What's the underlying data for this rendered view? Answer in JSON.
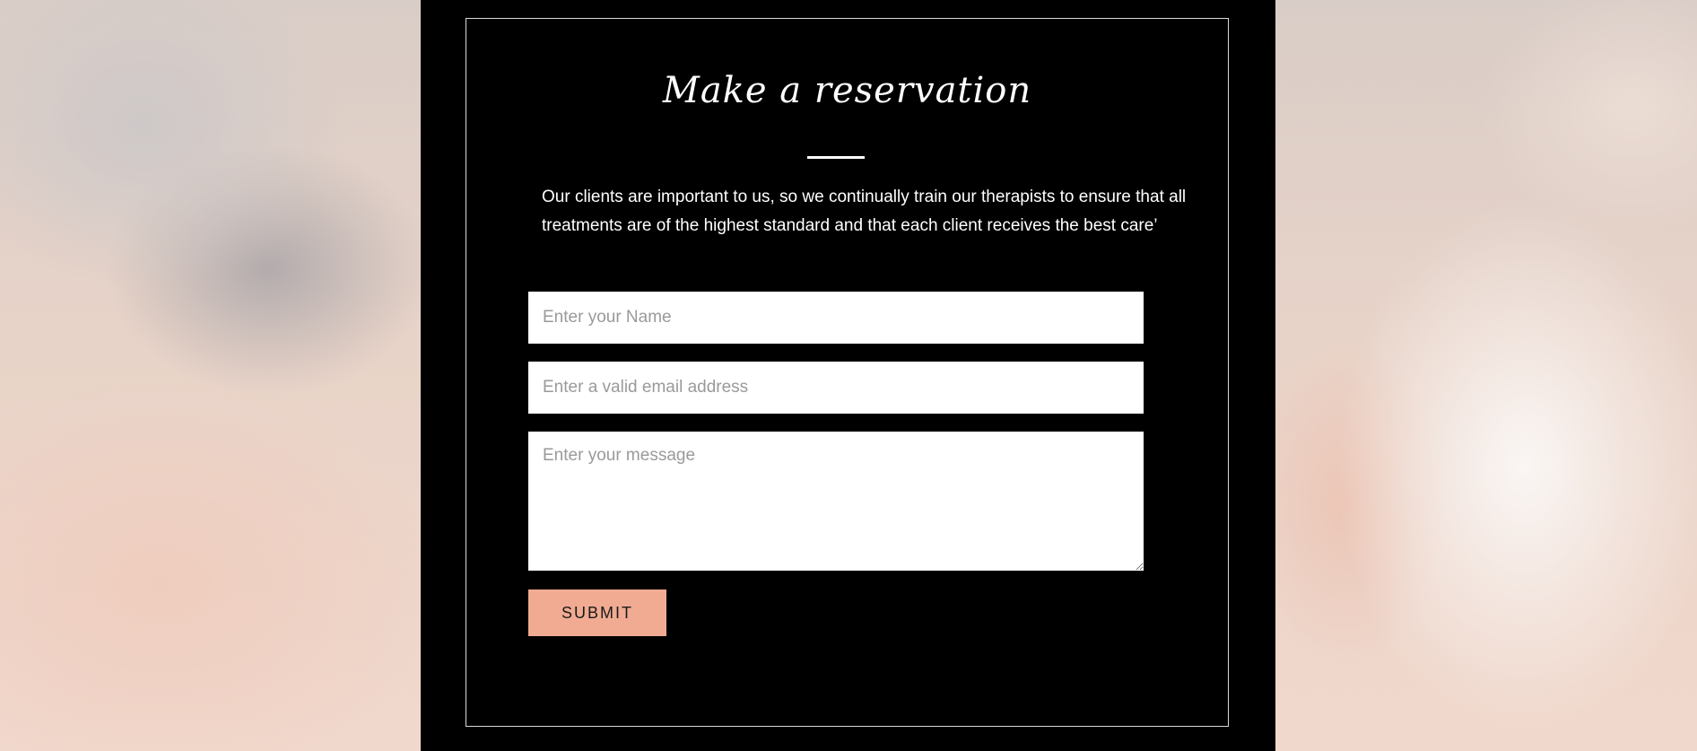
{
  "reservation": {
    "title": "Make a reservation",
    "intro": "Our clients are important to us, so we continually train our therapists to ensure that all treatments are of the highest standard and that each client receives the best care’",
    "form": {
      "name_placeholder": "Enter your Name",
      "email_placeholder": "Enter a valid email address",
      "message_placeholder": "Enter your message",
      "submit_label": "SUBMIT"
    }
  },
  "colors": {
    "panel_background": "#000000",
    "accent": "#f0ab92",
    "text": "#ffffff"
  }
}
